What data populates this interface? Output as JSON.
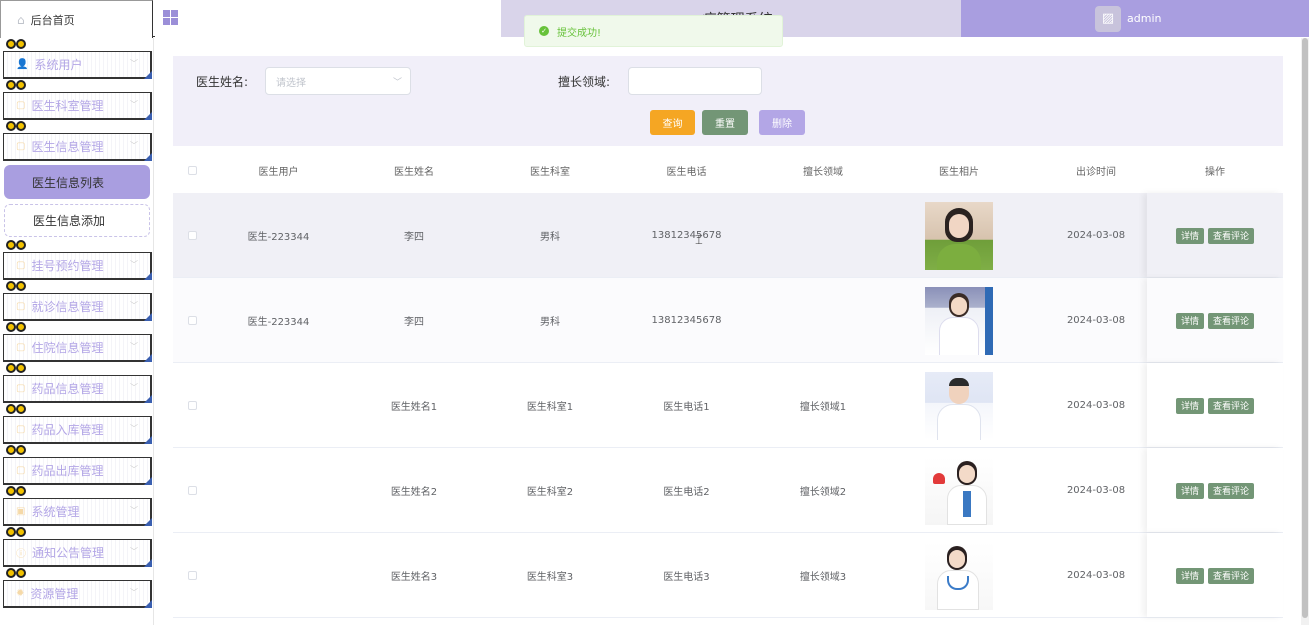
{
  "app": {
    "title": "...疗管理系统",
    "home_label": "后台首页",
    "user_name": "admin"
  },
  "toast": {
    "text": "提交成功!",
    "type": "success"
  },
  "sidebar": {
    "items": [
      {
        "label": "系统用户",
        "icon": "user-icon"
      },
      {
        "label": "医生科室管理",
        "icon": "folder-icon"
      },
      {
        "label": "医生信息管理",
        "icon": "folder-icon"
      },
      {
        "label": "挂号预约管理",
        "icon": "folder-icon"
      },
      {
        "label": "就诊信息管理",
        "icon": "folder-icon"
      },
      {
        "label": "住院信息管理",
        "icon": "folder-icon"
      },
      {
        "label": "药品信息管理",
        "icon": "folder-icon"
      },
      {
        "label": "药品入库管理",
        "icon": "folder-icon"
      },
      {
        "label": "药品出库管理",
        "icon": "folder-icon"
      },
      {
        "label": "系统管理",
        "icon": "settings-icon"
      },
      {
        "label": "通知公告管理",
        "icon": "info-icon"
      },
      {
        "label": "资源管理",
        "icon": "gear-icon"
      }
    ],
    "sub_items": [
      {
        "label": "医生信息列表",
        "active": true
      },
      {
        "label": "医生信息添加",
        "active": false
      }
    ]
  },
  "search": {
    "doctor_name_label": "医生姓名:",
    "doctor_name_placeholder": "请选择",
    "specialty_label": "擅长领域:",
    "specialty_value": "",
    "query_button": "查询",
    "reset_button": "重置",
    "delete_button": "删除"
  },
  "table": {
    "headers": [
      "医生用户",
      "医生姓名",
      "医生科室",
      "医生电话",
      "擅长领域",
      "医生相片",
      "出诊时间",
      "操作"
    ],
    "rows": [
      {
        "user": "医生-223344",
        "name": "李四",
        "dept": "男科",
        "phone": "13812345678",
        "specialty": "",
        "time": "2024-03-08"
      },
      {
        "user": "医生-223344",
        "name": "李四",
        "dept": "男科",
        "phone": "13812345678",
        "specialty": "",
        "time": "2024-03-08"
      },
      {
        "user": "",
        "name": "医生姓名1",
        "dept": "医生科室1",
        "phone": "医生电话1",
        "specialty": "擅长领域1",
        "time": "2024-03-08"
      },
      {
        "user": "",
        "name": "医生姓名2",
        "dept": "医生科室2",
        "phone": "医生电话2",
        "specialty": "擅长领域2",
        "time": "2024-03-08"
      },
      {
        "user": "",
        "name": "医生姓名3",
        "dept": "医生科室3",
        "phone": "医生电话3",
        "specialty": "擅长领域3",
        "time": "2024-03-08"
      }
    ],
    "detail_button": "详情",
    "comments_button": "查看评论"
  },
  "colors": {
    "accent": "#a99ee0",
    "accent_light": "#f1eff9",
    "op_button": "#739676",
    "query": "#f5a623"
  }
}
